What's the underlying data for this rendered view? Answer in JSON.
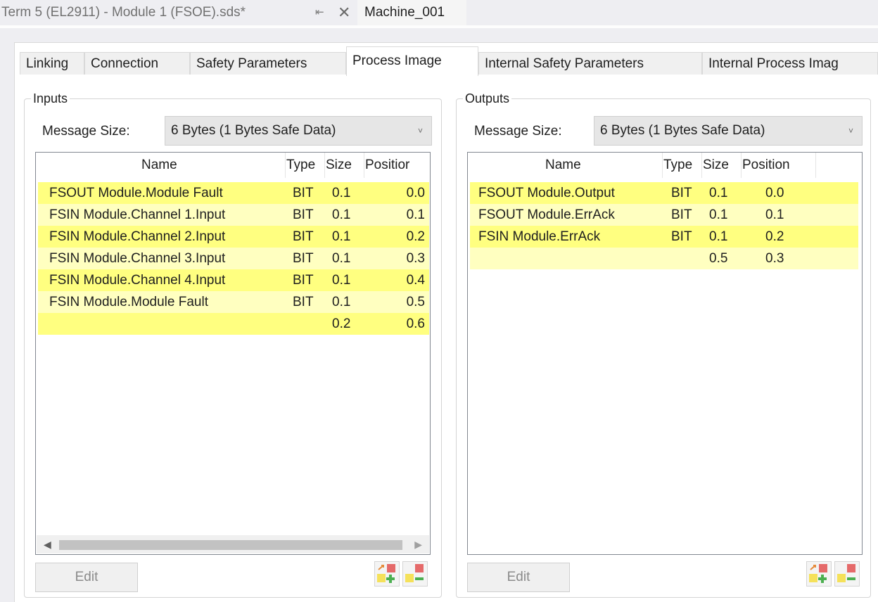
{
  "doc_tabs": {
    "file": "Term 5 (EL2911) - Module 1 (FSOE).sds*",
    "pin_icon": "pin-icon",
    "close_icon": "close-icon",
    "machine": "Machine_001"
  },
  "tabs": [
    "Linking",
    "Connection",
    "Safety Parameters",
    "Process Image",
    "Internal Safety Parameters",
    "Internal Process Imag"
  ],
  "selected_tab": "Process Image",
  "inputs": {
    "title": "Inputs",
    "message_size_label": "Message Size:",
    "message_size_value": "6 Bytes (1 Bytes Safe Data)",
    "columns": [
      "Name",
      "Type",
      "Size",
      "Positior"
    ],
    "rows": [
      {
        "name": "FSOUT Module.Module Fault",
        "type": "BIT",
        "size": "0.1",
        "position": "0.0"
      },
      {
        "name": "FSIN Module.Channel 1.Input",
        "type": "BIT",
        "size": "0.1",
        "position": "0.1"
      },
      {
        "name": "FSIN Module.Channel 2.Input",
        "type": "BIT",
        "size": "0.1",
        "position": "0.2"
      },
      {
        "name": "FSIN Module.Channel 3.Input",
        "type": "BIT",
        "size": "0.1",
        "position": "0.3"
      },
      {
        "name": "FSIN Module.Channel 4.Input",
        "type": "BIT",
        "size": "0.1",
        "position": "0.4"
      },
      {
        "name": "FSIN Module.Module Fault",
        "type": "BIT",
        "size": "0.1",
        "position": "0.5"
      },
      {
        "name": "",
        "type": "",
        "size": "0.2",
        "position": "0.6"
      }
    ],
    "edit_label": "Edit"
  },
  "outputs": {
    "title": "Outputs",
    "message_size_label": "Message Size:",
    "message_size_value": "6 Bytes (1 Bytes Safe Data)",
    "columns": [
      "Name",
      "Type",
      "Size",
      "Position"
    ],
    "rows": [
      {
        "name": "FSOUT Module.Output",
        "type": "BIT",
        "size": "0.1",
        "position": "0.0"
      },
      {
        "name": "FSOUT Module.ErrAck",
        "type": "BIT",
        "size": "0.1",
        "position": "0.1"
      },
      {
        "name": "FSIN Module.ErrAck",
        "type": "BIT",
        "size": "0.1",
        "position": "0.2"
      },
      {
        "name": "",
        "type": "",
        "size": "0.5",
        "position": "0.3"
      }
    ],
    "edit_label": "Edit"
  },
  "colors": {
    "row_yellow": "#ffff80",
    "row_light_yellow": "#ffffc0"
  }
}
